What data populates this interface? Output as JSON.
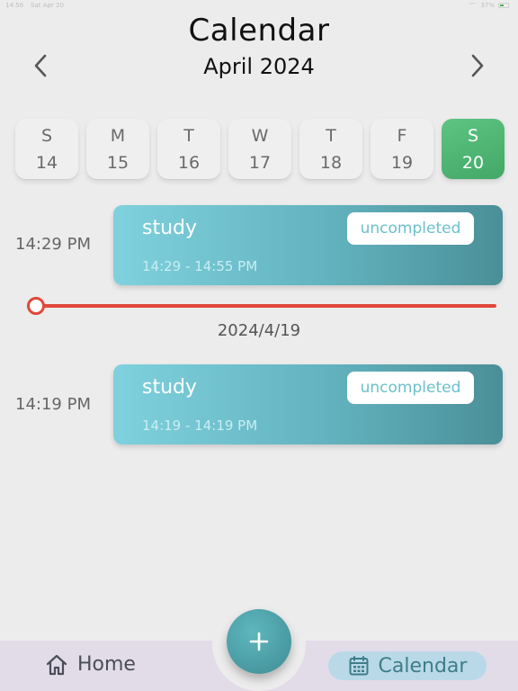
{
  "status": {
    "time": "14:56",
    "date": "Sat Apr 20",
    "battery": "37%"
  },
  "header": {
    "title": "Calendar",
    "month": "April 2024"
  },
  "week": [
    {
      "dow": "S",
      "date": "14"
    },
    {
      "dow": "M",
      "date": "15"
    },
    {
      "dow": "T",
      "date": "16"
    },
    {
      "dow": "W",
      "date": "17"
    },
    {
      "dow": "T",
      "date": "18"
    },
    {
      "dow": "F",
      "date": "19"
    },
    {
      "dow": "S",
      "date": "20",
      "selected": true
    }
  ],
  "events": [
    {
      "time": "14:29 PM",
      "title": "study",
      "range": "14:29 - 14:55 PM",
      "status": "uncompleted"
    },
    {
      "time": "14:19 PM",
      "title": "study",
      "range": "14:19 - 14:19 PM",
      "status": "uncompleted"
    }
  ],
  "separator_date": "2024/4/19",
  "tabs": {
    "home": "Home",
    "calendar": "Calendar"
  },
  "colors": {
    "accent_green": "#4fb672",
    "card_teal": "#62b3bf",
    "now_red": "#e0483a",
    "tab_active": "#3e7d88"
  }
}
